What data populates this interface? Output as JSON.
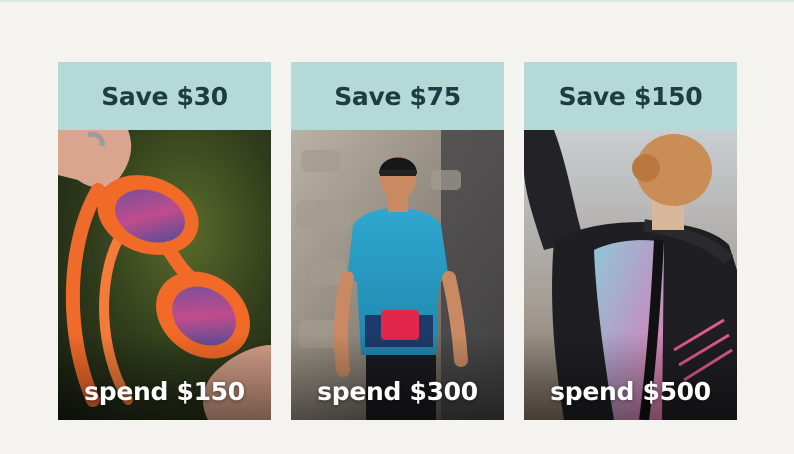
{
  "colors": {
    "page_background": "#f4f3f0",
    "header_band": "#b5d9d7",
    "header_text": "#1d3d42",
    "footer_text": "#ffffff"
  },
  "offers": [
    {
      "save_label": "Save $30",
      "spend_label": "spend $150",
      "image": "orange-swim-goggles-photo"
    },
    {
      "save_label": "Save $75",
      "spend_label": "spend $300",
      "image": "triathlete-trisuit-photo"
    },
    {
      "save_label": "Save $150",
      "spend_label": "spend $500",
      "image": "wetsuit-back-photo"
    }
  ]
}
